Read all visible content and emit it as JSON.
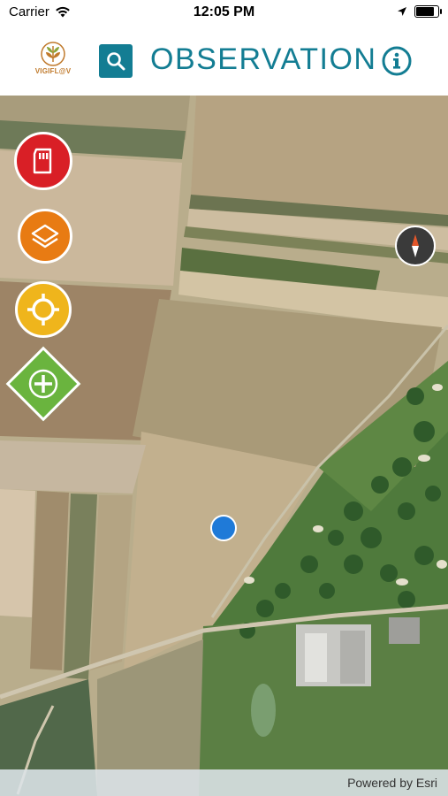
{
  "status_bar": {
    "carrier": "Carrier",
    "time": "12:05 PM",
    "battery_level": 0.9
  },
  "header": {
    "logo_text": "VIGIFL@V",
    "title": "OBSERVATION",
    "search_icon": "search-icon",
    "info_icon": "info-icon"
  },
  "map": {
    "tools": [
      {
        "name": "save",
        "icon": "sd-card-icon",
        "color": "#d91f26"
      },
      {
        "name": "layers",
        "icon": "layers-icon",
        "color": "#e87b13"
      },
      {
        "name": "locate",
        "icon": "crosshair-icon",
        "color": "#efb51c"
      },
      {
        "name": "add",
        "icon": "plus-icon",
        "color": "#6ab43e"
      }
    ],
    "compass_icon": "compass-icon",
    "attribution": "Powered by Esri"
  },
  "colors": {
    "accent": "#137d93",
    "user_location": "#1f7ad8"
  }
}
